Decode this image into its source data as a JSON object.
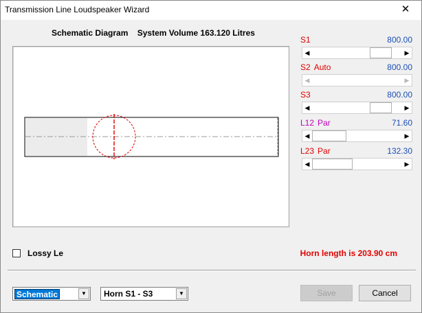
{
  "window": {
    "title": "Transmission Line Loudspeaker Wizard",
    "close_glyph": "✕"
  },
  "diagram": {
    "title": "Schematic Diagram",
    "volume_label": "System Volume 163.120 Litres"
  },
  "sliders": [
    {
      "name": "S1",
      "mode": "",
      "value": "800.00",
      "name_color": "#e00000",
      "arrows_enabled": true,
      "thumb_fraction": 1.0
    },
    {
      "name": "S2",
      "mode": "Auto",
      "value": "800.00",
      "name_color": "#e00000",
      "arrows_enabled": false,
      "thumb_fraction": null
    },
    {
      "name": "S3",
      "mode": "",
      "value": "800.00",
      "name_color": "#e00000",
      "arrows_enabled": true,
      "thumb_fraction": 1.0
    },
    {
      "name": "L12",
      "mode": "Par",
      "value": "71.60",
      "name_color": "#c000c0",
      "arrows_enabled": true,
      "thumb_fraction": 0.27
    },
    {
      "name": "L23",
      "mode": "Par",
      "value": "132.30",
      "name_color": "#e00000",
      "arrows_enabled": true,
      "thumb_fraction": 0.33
    }
  ],
  "lossy": {
    "label": "Lossy Le",
    "checked": false
  },
  "horn_length": "Horn length is 203.90 cm",
  "view_select": {
    "value": "Schematic"
  },
  "horn_select": {
    "value": "Horn S1 - S3"
  },
  "buttons": {
    "save": "Save",
    "cancel": "Cancel"
  },
  "icons": {
    "arrow_left": "◀",
    "arrow_right": "▶",
    "arrow_down": "▼"
  },
  "colors": {
    "value_blue": "#1b4fb5",
    "horn_red": "#e30000",
    "driver_red": "#e00000",
    "select_highlight": "#0078d7"
  }
}
